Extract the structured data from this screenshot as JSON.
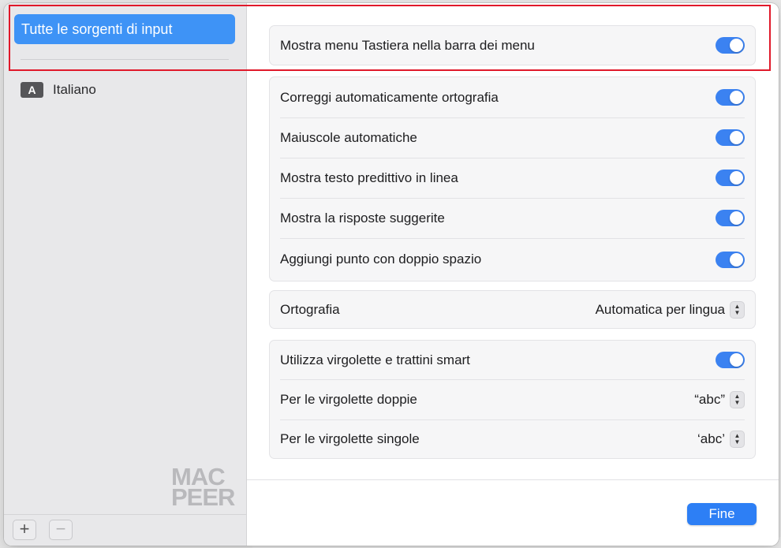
{
  "sidebar": {
    "selected_label": "Tutte le sorgenti di input",
    "items": [
      {
        "badge": "A",
        "label": "Italiano"
      }
    ],
    "add_label": "+",
    "remove_label": "−",
    "watermark_line1": "MAC",
    "watermark_line2": "PEER"
  },
  "settings": {
    "menu_toggle": {
      "label": "Mostra menu Tastiera nella barra dei menu",
      "on": true
    },
    "typing": [
      {
        "label": "Correggi automaticamente ortografia",
        "on": true
      },
      {
        "label": "Maiuscole automatiche",
        "on": true
      },
      {
        "label": "Mostra testo predittivo in linea",
        "on": true
      },
      {
        "label": "Mostra la risposte suggerite",
        "on": true
      },
      {
        "label": "Aggiungi punto con doppio spazio",
        "on": true
      }
    ],
    "spelling": {
      "label": "Ortografia",
      "value": "Automatica per lingua"
    },
    "quotes": {
      "smart": {
        "label": "Utilizza virgolette e trattini smart",
        "on": true
      },
      "double": {
        "label": "Per le virgolette doppie",
        "value": "“abc”"
      },
      "single": {
        "label": "Per le virgolette singole",
        "value": "‘abc’"
      }
    }
  },
  "footer": {
    "done_label": "Fine"
  },
  "colors": {
    "accent": "#3e93f6",
    "toggle_on": "#3b82f1",
    "highlight": "#e0192a"
  }
}
